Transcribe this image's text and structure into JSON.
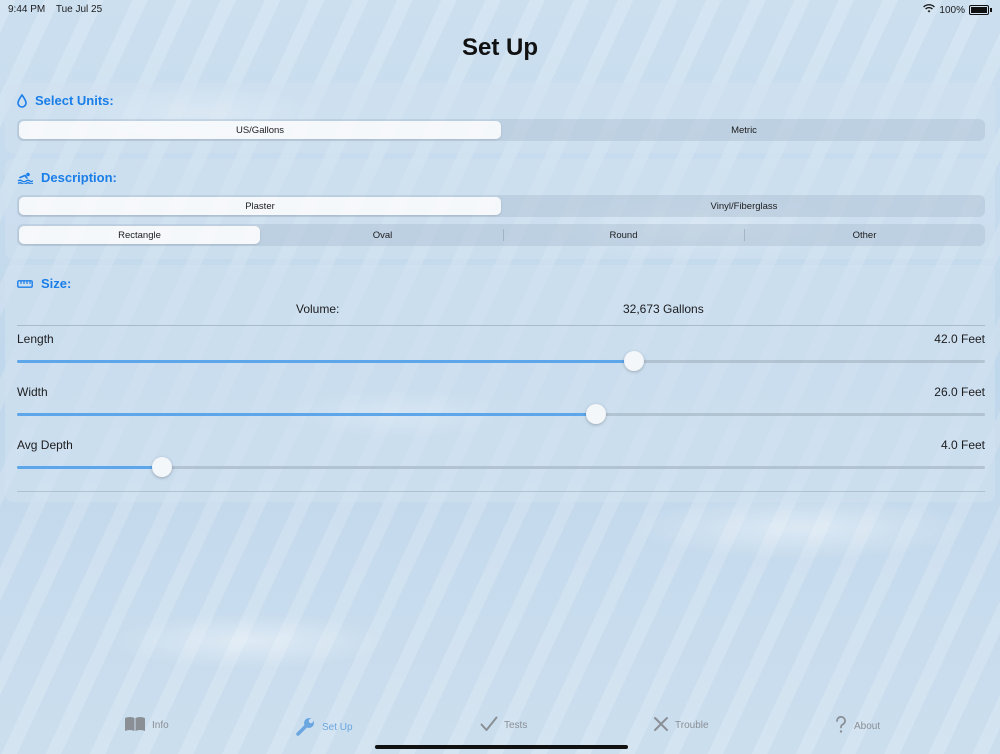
{
  "status": {
    "time": "9:44 PM",
    "date": "Tue Jul 25",
    "battery": "100%"
  },
  "title": "Set Up",
  "units": {
    "header": "Select Units:",
    "options": [
      "US/Gallons",
      "Metric"
    ],
    "selected_index": 0
  },
  "description": {
    "header": "Description:",
    "finish_options": [
      "Plaster",
      "Vinyl/Fiberglass"
    ],
    "finish_selected_index": 0,
    "shape_options": [
      "Rectangle",
      "Oval",
      "Round",
      "Other"
    ],
    "shape_selected_index": 0
  },
  "size": {
    "header": "Size:",
    "volume_label": "Volume:",
    "volume_value": "32,673 Gallons",
    "sliders": [
      {
        "label": "Length",
        "value": "42.0 Feet",
        "fraction": 0.637
      },
      {
        "label": "Width",
        "value": "26.0 Feet",
        "fraction": 0.598
      },
      {
        "label": "Avg Depth",
        "value": "4.0 Feet",
        "fraction": 0.15
      }
    ]
  },
  "tabs": [
    {
      "label": "Info",
      "icon": "book-icon",
      "active": false
    },
    {
      "label": "Set Up",
      "icon": "wrench-icon",
      "active": true
    },
    {
      "label": "Tests",
      "icon": "checkmark-icon",
      "active": false
    },
    {
      "label": "Trouble",
      "icon": "x-icon",
      "active": false
    },
    {
      "label": "About",
      "icon": "question-icon",
      "active": false
    }
  ],
  "colors": {
    "accent": "#1a7ee8",
    "active_tab": "#6aa6e0",
    "inactive_tab": "#8a8f96"
  }
}
